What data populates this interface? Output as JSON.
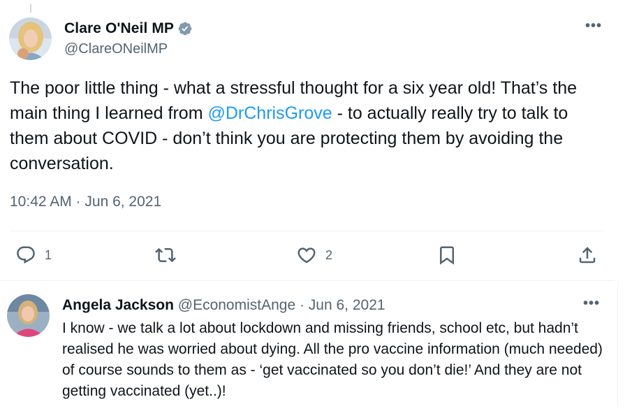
{
  "tweet": {
    "author_name": "Clare O'Neil MP",
    "author_handle": "@ClareONeilMP",
    "text_before": "The poor little thing - what a stressful thought for a six year old! That’s the main thing I learned from ",
    "mention": "@DrChrisGrove",
    "text_after": " - to actually really try to talk to them about COVID - don’t think you are protecting them by avoiding the conversation.",
    "timestamp": "10:42 AM · Jun 6, 2021",
    "more": "•••",
    "verified_icon": "verified-badge-icon"
  },
  "actions": {
    "reply_count": "1",
    "like_count": "2",
    "icons": [
      "reply-icon",
      "retweet-icon",
      "like-icon",
      "bookmark-icon",
      "share-icon"
    ]
  },
  "reply": {
    "author_name": "Angela Jackson",
    "meta": "@EconomistAnge · Jun 6, 2021",
    "text": "I know - we talk a lot about lockdown and missing friends, school etc, but hadn’t realised he was worried about dying. All the pro vaccine information (much needed) of course sounds to them as - ‘get vaccinated so you don’t die!’ And they are not getting vaccinated (yet..)!",
    "more": "•••"
  },
  "colors": {
    "accent": "#1d9bf0",
    "muted": "#536471",
    "text": "#0f1419",
    "verified": "#829aab"
  }
}
